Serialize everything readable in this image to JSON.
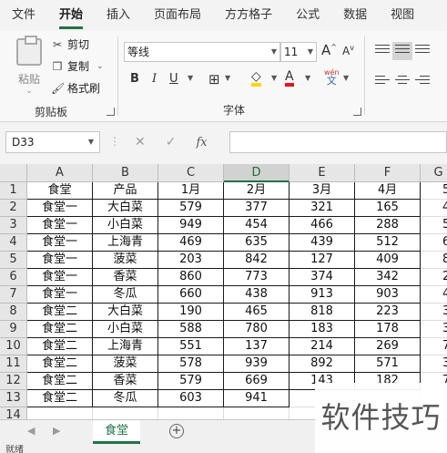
{
  "tabs": [
    "文件",
    "开始",
    "插入",
    "页面布局",
    "方方格子",
    "公式",
    "数据",
    "视图"
  ],
  "active_tab": 1,
  "ribbon": {
    "clipboard": {
      "paste": "粘贴",
      "cut": "剪切",
      "copy": "复制",
      "format_painter": "格式刷",
      "group_label": "剪贴板"
    },
    "font": {
      "family": "等线",
      "size": "11",
      "bold": "B",
      "italic": "I",
      "underline": "U",
      "grow": "A",
      "shrink": "A",
      "phonetic_top": "wén",
      "phonetic_bottom": "文",
      "group_label": "字体",
      "font_color": "#e81123",
      "fill_color": "#ffd700"
    }
  },
  "formula_bar": {
    "name_box": "D33",
    "fx": "fx",
    "cancel": "✕",
    "enter": "✓",
    "value": ""
  },
  "grid": {
    "columns": [
      "A",
      "B",
      "C",
      "D",
      "E",
      "F",
      "G"
    ],
    "selected_column": "D",
    "rows": [
      [
        "食堂",
        "产品",
        "1月",
        "2月",
        "3月",
        "4月",
        "5"
      ],
      [
        "食堂一",
        "大白菜",
        "579",
        "377",
        "321",
        "165",
        "4"
      ],
      [
        "食堂一",
        "小白菜",
        "949",
        "454",
        "466",
        "288",
        "5"
      ],
      [
        "食堂一",
        "上海青",
        "469",
        "635",
        "439",
        "512",
        "6"
      ],
      [
        "食堂一",
        "菠菜",
        "203",
        "842",
        "127",
        "409",
        "8"
      ],
      [
        "食堂一",
        "香菜",
        "860",
        "773",
        "374",
        "342",
        "2"
      ],
      [
        "食堂一",
        "冬瓜",
        "660",
        "438",
        "913",
        "903",
        "4"
      ],
      [
        "食堂二",
        "大白菜",
        "190",
        "465",
        "818",
        "223",
        "3"
      ],
      [
        "食堂二",
        "小白菜",
        "588",
        "780",
        "183",
        "178",
        "3"
      ],
      [
        "食堂二",
        "上海青",
        "551",
        "137",
        "214",
        "269",
        "7"
      ],
      [
        "食堂二",
        "菠菜",
        "578",
        "939",
        "892",
        "571",
        "3"
      ],
      [
        "食堂二",
        "香菜",
        "579",
        "669",
        "143",
        "182",
        "7"
      ],
      [
        "食堂二",
        "冬瓜",
        "603",
        "941",
        "",
        "",
        ""
      ]
    ],
    "row_numbers": [
      "1",
      "2",
      "3",
      "4",
      "5",
      "6",
      "7",
      "8",
      "9",
      "10",
      "11",
      "12",
      "13",
      "14"
    ]
  },
  "sheet_tabs": [
    "食堂"
  ],
  "status": "就绪",
  "watermark": "软件技巧"
}
